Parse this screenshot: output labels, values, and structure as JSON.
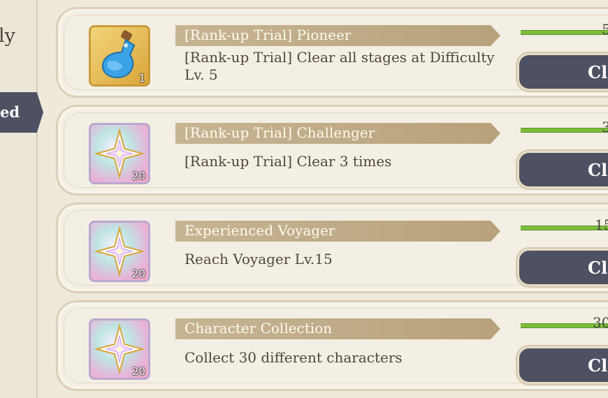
{
  "sidebar": {
    "partial_label": "ly",
    "tab_label": "ed"
  },
  "quests": [
    {
      "title": "[Rank-up Trial] Pioneer",
      "description": "[Rank-up Trial] Clear all stages at Difficulty Lv. 5",
      "reward_icon": "potion-icon",
      "reward_qty": "1",
      "progress_text": "5",
      "progress": 1.0,
      "claim_label": "Cla"
    },
    {
      "title": "[Rank-up Trial] Challenger",
      "description": "[Rank-up Trial] Clear 3 times",
      "reward_icon": "crystal-star-icon",
      "reward_qty": "20",
      "progress_text": "3",
      "progress": 1.0,
      "claim_label": "Cla"
    },
    {
      "title": "Experienced Voyager",
      "description": "Reach Voyager Lv.15",
      "reward_icon": "crystal-star-icon",
      "reward_qty": "20",
      "progress_text": "15",
      "progress": 1.0,
      "claim_label": "Cla"
    },
    {
      "title": "Character Collection",
      "description": "Collect 30 different characters",
      "reward_icon": "crystal-star-icon",
      "reward_qty": "20",
      "progress_text": "30",
      "progress": 1.0,
      "claim_label": "Cla"
    }
  ],
  "colors": {
    "background": "#efe9dc",
    "ribbon": "#c2ae8a",
    "progress_fill": "#7bbf3a",
    "claim_button": "#4d5161"
  }
}
